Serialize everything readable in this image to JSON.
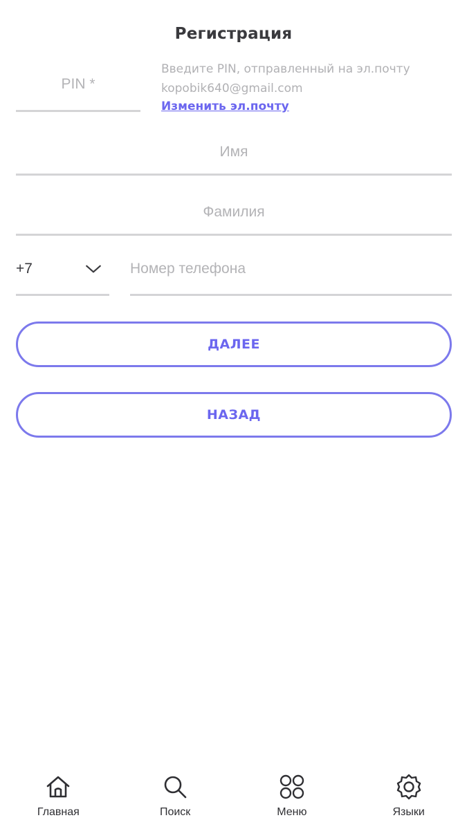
{
  "header": {
    "title": "Регистрация"
  },
  "pin": {
    "placeholder": "PIN *",
    "hint": "Введите PIN, отправленный на эл.почту",
    "email": "kopobik640@gmail.com",
    "change_link": "Изменить эл.почту"
  },
  "form": {
    "first_name_placeholder": "Имя",
    "last_name_placeholder": "Фамилия",
    "country_code": "+7",
    "phone_placeholder": "Номер телефона"
  },
  "buttons": {
    "next": "ДАЛЕЕ",
    "back": "НАЗАД"
  },
  "bottom_nav": {
    "items": [
      {
        "label": "Главная",
        "icon": "home-icon"
      },
      {
        "label": "Поиск",
        "icon": "search-icon"
      },
      {
        "label": "Меню",
        "icon": "menu-grid-icon"
      },
      {
        "label": "Языки",
        "icon": "gear-icon"
      }
    ]
  },
  "colors": {
    "accent": "#6b66ef",
    "border": "#d4d4d6",
    "placeholder": "#b3b3b6"
  }
}
